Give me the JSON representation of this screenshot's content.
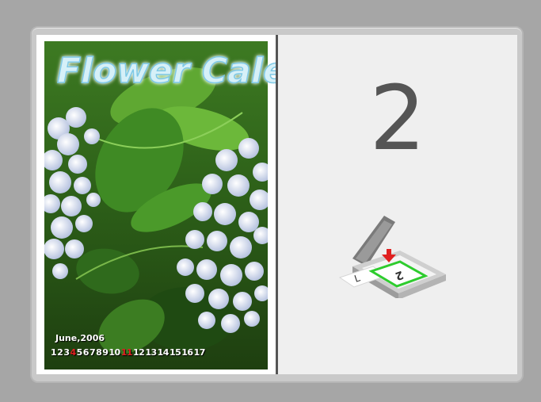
{
  "preview": {
    "left_page": {
      "calendar_title": "Flower Calend",
      "calendar_month": "June,2006",
      "calendar_days": [
        "1",
        "2",
        "3",
        "4",
        "5",
        "6",
        "7",
        "8",
        "9",
        "10",
        "11",
        "12",
        "13",
        "14",
        "15",
        "16",
        "17"
      ],
      "highlight_days": [
        "4",
        "11"
      ]
    },
    "right_page": {
      "page_number": "2"
    }
  },
  "colors": {
    "frame_bg": "#c9c9c9",
    "divider": "#555555",
    "right_page_bg": "#efefef",
    "scan_target_green": "#2ecc2e",
    "arrow_red": "#e02020"
  },
  "icons": [
    "scanner-icon",
    "down-arrow-icon"
  ]
}
